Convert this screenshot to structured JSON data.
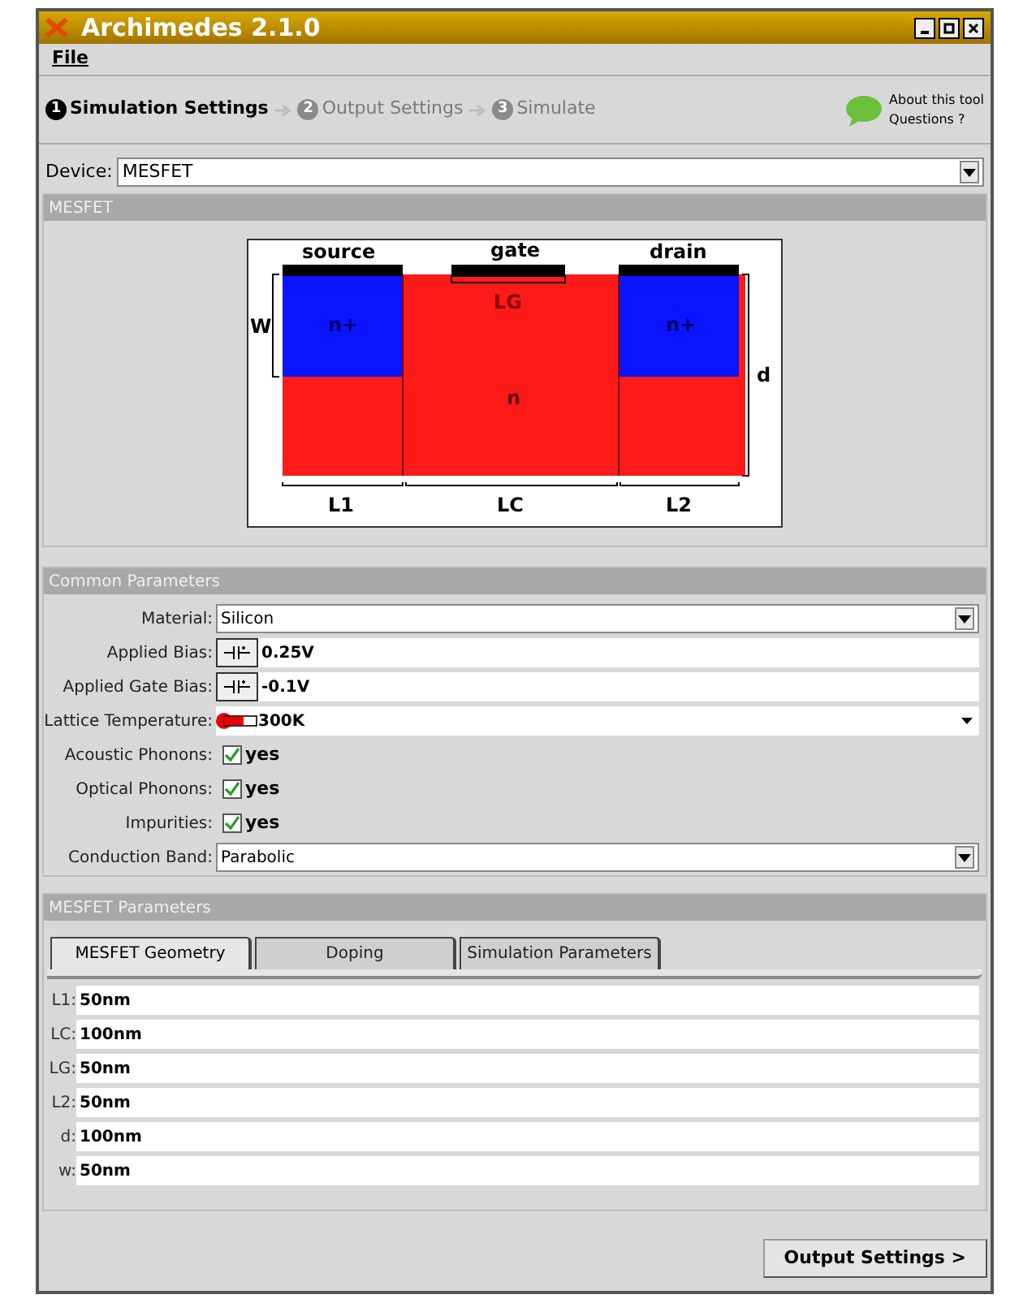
{
  "window": {
    "title": "Archimedes 2.1.0"
  },
  "menu": [
    "File"
  ],
  "steps": [
    {
      "number": "1",
      "label": "Simulation Settings",
      "selected": true
    },
    {
      "number": "2",
      "label": "Output Settings",
      "selected": false
    },
    {
      "number": "3",
      "label": "Simulate",
      "selected": false
    }
  ],
  "help": {
    "lines": [
      "About this tool",
      "Questions ?"
    ]
  },
  "device": {
    "label": "Device:",
    "value": "MESFET"
  },
  "diagram_section": {
    "title": "MESFET",
    "labels": {
      "source": "source",
      "gate": "gate",
      "drain": "drain",
      "lg": "LG",
      "left_doping": "n+",
      "right_doping": "n+",
      "channel": "n",
      "w": "W",
      "d": "d",
      "l1": "L1",
      "lc": "LC",
      "l2": "L2"
    }
  },
  "common_parameters": {
    "title": "Common Parameters",
    "rows": [
      {
        "kind": "dropdown",
        "label": "Material:",
        "value": "Silicon"
      },
      {
        "kind": "bias",
        "label": "Applied Bias:",
        "value": "0.25V"
      },
      {
        "kind": "bias",
        "label": "Applied Gate Bias:",
        "value": "-0.1V"
      },
      {
        "kind": "temperature",
        "label": "Lattice Temperature:",
        "value": "300K"
      },
      {
        "kind": "checkbox",
        "label": "Acoustic Phonons:",
        "value": "yes",
        "checked": true
      },
      {
        "kind": "checkbox",
        "label": "Optical Phonons:",
        "value": "yes",
        "checked": true
      },
      {
        "kind": "checkbox",
        "label": "Impurities:",
        "value": "yes",
        "checked": true
      },
      {
        "kind": "dropdown",
        "label": "Conduction Band:",
        "value": "Parabolic"
      }
    ]
  },
  "mesfet_parameters": {
    "title": "MESFET Parameters",
    "tabs": [
      {
        "label": "MESFET Geometry",
        "selected": true
      },
      {
        "label": "Doping",
        "selected": false
      },
      {
        "label": "Simulation Parameters",
        "selected": false
      }
    ],
    "fields": [
      {
        "label": "L1:",
        "value": "50nm"
      },
      {
        "label": "LC:",
        "value": "100nm"
      },
      {
        "label": "LG:",
        "value": "50nm"
      },
      {
        "label": "L2:",
        "value": "50nm"
      },
      {
        "label": "d:",
        "value": "100nm"
      },
      {
        "label": "w:",
        "value": "50nm"
      }
    ]
  },
  "next_button": "Output Settings >"
}
